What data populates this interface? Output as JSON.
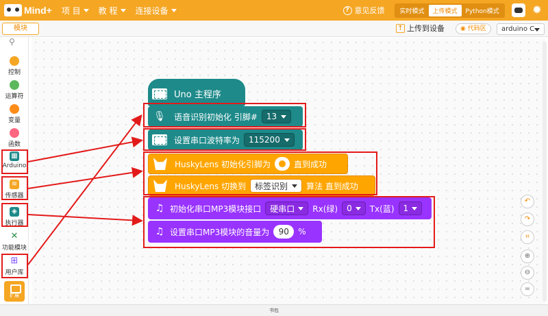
{
  "app": {
    "logo_text": "Mind+"
  },
  "menu": [
    {
      "label": "项 目"
    },
    {
      "label": "教 程"
    },
    {
      "label": "连接设备"
    }
  ],
  "top_right": {
    "feedback": "意见反馈",
    "modes": [
      "实时模式",
      "上传模式",
      "Python模式"
    ],
    "active_mode": "上传模式"
  },
  "toolbar": {
    "modules_tab": "模块",
    "upload": "上传到设备",
    "code_region": "代码区",
    "board": "arduino C"
  },
  "sidebar": {
    "items": [
      {
        "label": "控制",
        "color": "#f5a623"
      },
      {
        "label": "运算符",
        "color": "#5cb85c"
      },
      {
        "label": "变量",
        "color": "#ff8c1a"
      },
      {
        "label": "函数",
        "color": "#ff6680"
      },
      {
        "label": "Arduino",
        "color": "#1e8a8a"
      },
      {
        "label": "传感器",
        "color": "#f5a623"
      },
      {
        "label": "执行器",
        "color": "#1e8a8a"
      },
      {
        "label": "功能模块",
        "color": "#2a8f4a"
      },
      {
        "label": "用户库",
        "color": "#7c4dff"
      }
    ],
    "extension": "扩展"
  },
  "blocks": {
    "hat": "Uno 主程序",
    "voice": {
      "text": "语音识别初始化 引脚#",
      "pin": "13"
    },
    "serial": {
      "text": "设置串口波特率为",
      "baud": "115200"
    },
    "husky_init": {
      "prefix": "HuskyLens 初始化引脚为",
      "suffix": "直到成功"
    },
    "husky_switch": {
      "prefix": "HuskyLens 切换到",
      "algo": "标签识别",
      "suffix": "算法 直到成功"
    },
    "mp3_init": {
      "text": "初始化串口MP3模块接口",
      "port": "硬串口",
      "rx_label": "Rx(绿)",
      "rx": "0",
      "tx_label": "Tx(蓝)",
      "tx": "1"
    },
    "mp3_volume": {
      "text": "设置串口MP3模块的音量为",
      "volume": "90",
      "unit": "%"
    }
  },
  "bottom": {
    "label": "书包"
  }
}
